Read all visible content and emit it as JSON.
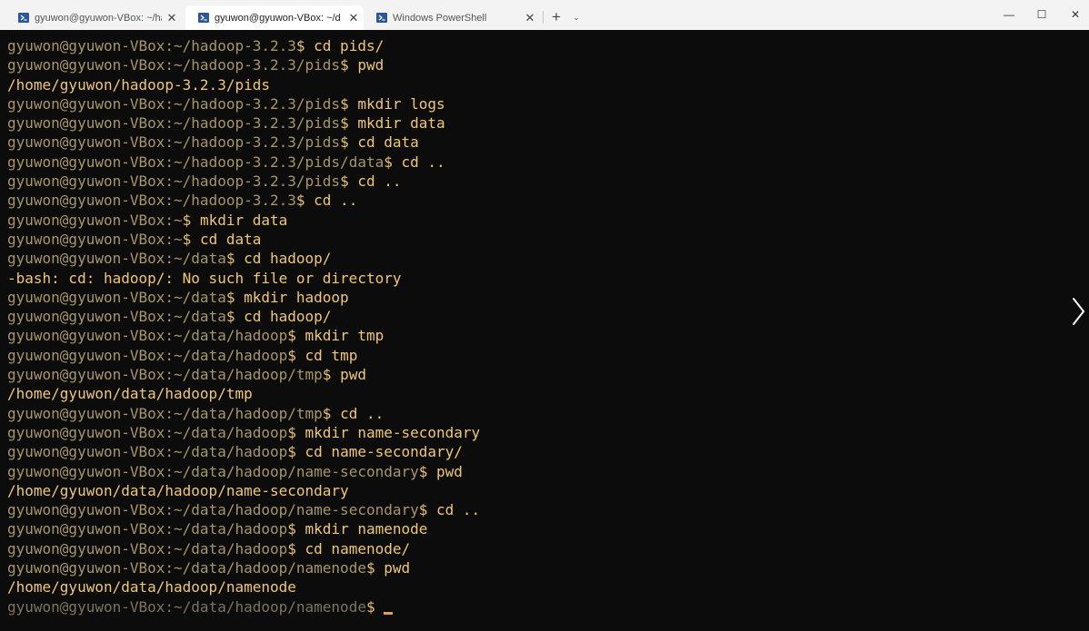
{
  "tabs": [
    {
      "label": "gyuwon@gyuwon-VBox: ~/ha",
      "active": false
    },
    {
      "label": "gyuwon@gyuwon-VBox: ~/d",
      "active": true
    },
    {
      "label": "Windows PowerShell",
      "active": false
    }
  ],
  "titlebar": {
    "close_glyph": "✕",
    "new_tab_glyph": "+",
    "dropdown_glyph": "⌄",
    "minimize_glyph": "—",
    "maximize_glyph": "☐",
    "window_close_glyph": "✕"
  },
  "colors": {
    "background": "#0c0c0c",
    "prompt_dim": "#a8966a",
    "command": "#f0c774",
    "cursor": "#e0a060"
  },
  "icons": {
    "tab_icon": "powershell-icon",
    "scroll_right": "chevron-right-icon"
  },
  "terminal": {
    "lines": [
      {
        "userhost": "gyuwon@gyuwon-VBox",
        "path": "~/hadoop-3.2.3",
        "cmd": "cd pids/"
      },
      {
        "userhost": "gyuwon@gyuwon-VBox",
        "path": "~/hadoop-3.2.3/pids",
        "cmd": "pwd"
      },
      {
        "output": "/home/gyuwon/hadoop-3.2.3/pids"
      },
      {
        "userhost": "gyuwon@gyuwon-VBox",
        "path": "~/hadoop-3.2.3/pids",
        "cmd": "mkdir logs"
      },
      {
        "userhost": "gyuwon@gyuwon-VBox",
        "path": "~/hadoop-3.2.3/pids",
        "cmd": "mkdir data"
      },
      {
        "userhost": "gyuwon@gyuwon-VBox",
        "path": "~/hadoop-3.2.3/pids",
        "cmd": "cd data"
      },
      {
        "userhost": "gyuwon@gyuwon-VBox",
        "path": "~/hadoop-3.2.3/pids/data",
        "cmd": "cd .."
      },
      {
        "userhost": "gyuwon@gyuwon-VBox",
        "path": "~/hadoop-3.2.3/pids",
        "cmd": "cd .."
      },
      {
        "userhost": "gyuwon@gyuwon-VBox",
        "path": "~/hadoop-3.2.3",
        "cmd": "cd .."
      },
      {
        "userhost": "gyuwon@gyuwon-VBox",
        "path": "~",
        "cmd": "mkdir data"
      },
      {
        "userhost": "gyuwon@gyuwon-VBox",
        "path": "~",
        "cmd": "cd data"
      },
      {
        "userhost": "gyuwon@gyuwon-VBox",
        "path": "~/data",
        "cmd": "cd hadoop/"
      },
      {
        "output": "-bash: cd: hadoop/: No such file or directory"
      },
      {
        "userhost": "gyuwon@gyuwon-VBox",
        "path": "~/data",
        "cmd": "mkdir hadoop"
      },
      {
        "userhost": "gyuwon@gyuwon-VBox",
        "path": "~/data",
        "cmd": "cd hadoop/"
      },
      {
        "userhost": "gyuwon@gyuwon-VBox",
        "path": "~/data/hadoop",
        "cmd": "mkdir tmp"
      },
      {
        "userhost": "gyuwon@gyuwon-VBox",
        "path": "~/data/hadoop",
        "cmd": "cd tmp"
      },
      {
        "userhost": "gyuwon@gyuwon-VBox",
        "path": "~/data/hadoop/tmp",
        "cmd": "pwd"
      },
      {
        "output": "/home/gyuwon/data/hadoop/tmp"
      },
      {
        "userhost": "gyuwon@gyuwon-VBox",
        "path": "~/data/hadoop/tmp",
        "cmd": "cd .."
      },
      {
        "userhost": "gyuwon@gyuwon-VBox",
        "path": "~/data/hadoop",
        "cmd": "mkdir name-secondary"
      },
      {
        "userhost": "gyuwon@gyuwon-VBox",
        "path": "~/data/hadoop",
        "cmd": "cd name-secondary/"
      },
      {
        "userhost": "gyuwon@gyuwon-VBox",
        "path": "~/data/hadoop/name-secondary",
        "cmd": "pwd"
      },
      {
        "output": "/home/gyuwon/data/hadoop/name-secondary"
      },
      {
        "userhost": "gyuwon@gyuwon-VBox",
        "path": "~/data/hadoop/name-secondary",
        "cmd": "cd .."
      },
      {
        "userhost": "gyuwon@gyuwon-VBox",
        "path": "~/data/hadoop",
        "cmd": "mkdir namenode"
      },
      {
        "userhost": "gyuwon@gyuwon-VBox",
        "path": "~/data/hadoop",
        "cmd": "cd namenode/"
      },
      {
        "userhost": "gyuwon@gyuwon-VBox",
        "path": "~/data/hadoop/namenode",
        "cmd": "pwd"
      },
      {
        "output": "/home/gyuwon/data/hadoop/namenode"
      },
      {
        "userhost": "gyuwon@gyuwon-VBox",
        "path": "~/data/hadoop/namenode",
        "cmd": "",
        "current": true
      }
    ]
  }
}
